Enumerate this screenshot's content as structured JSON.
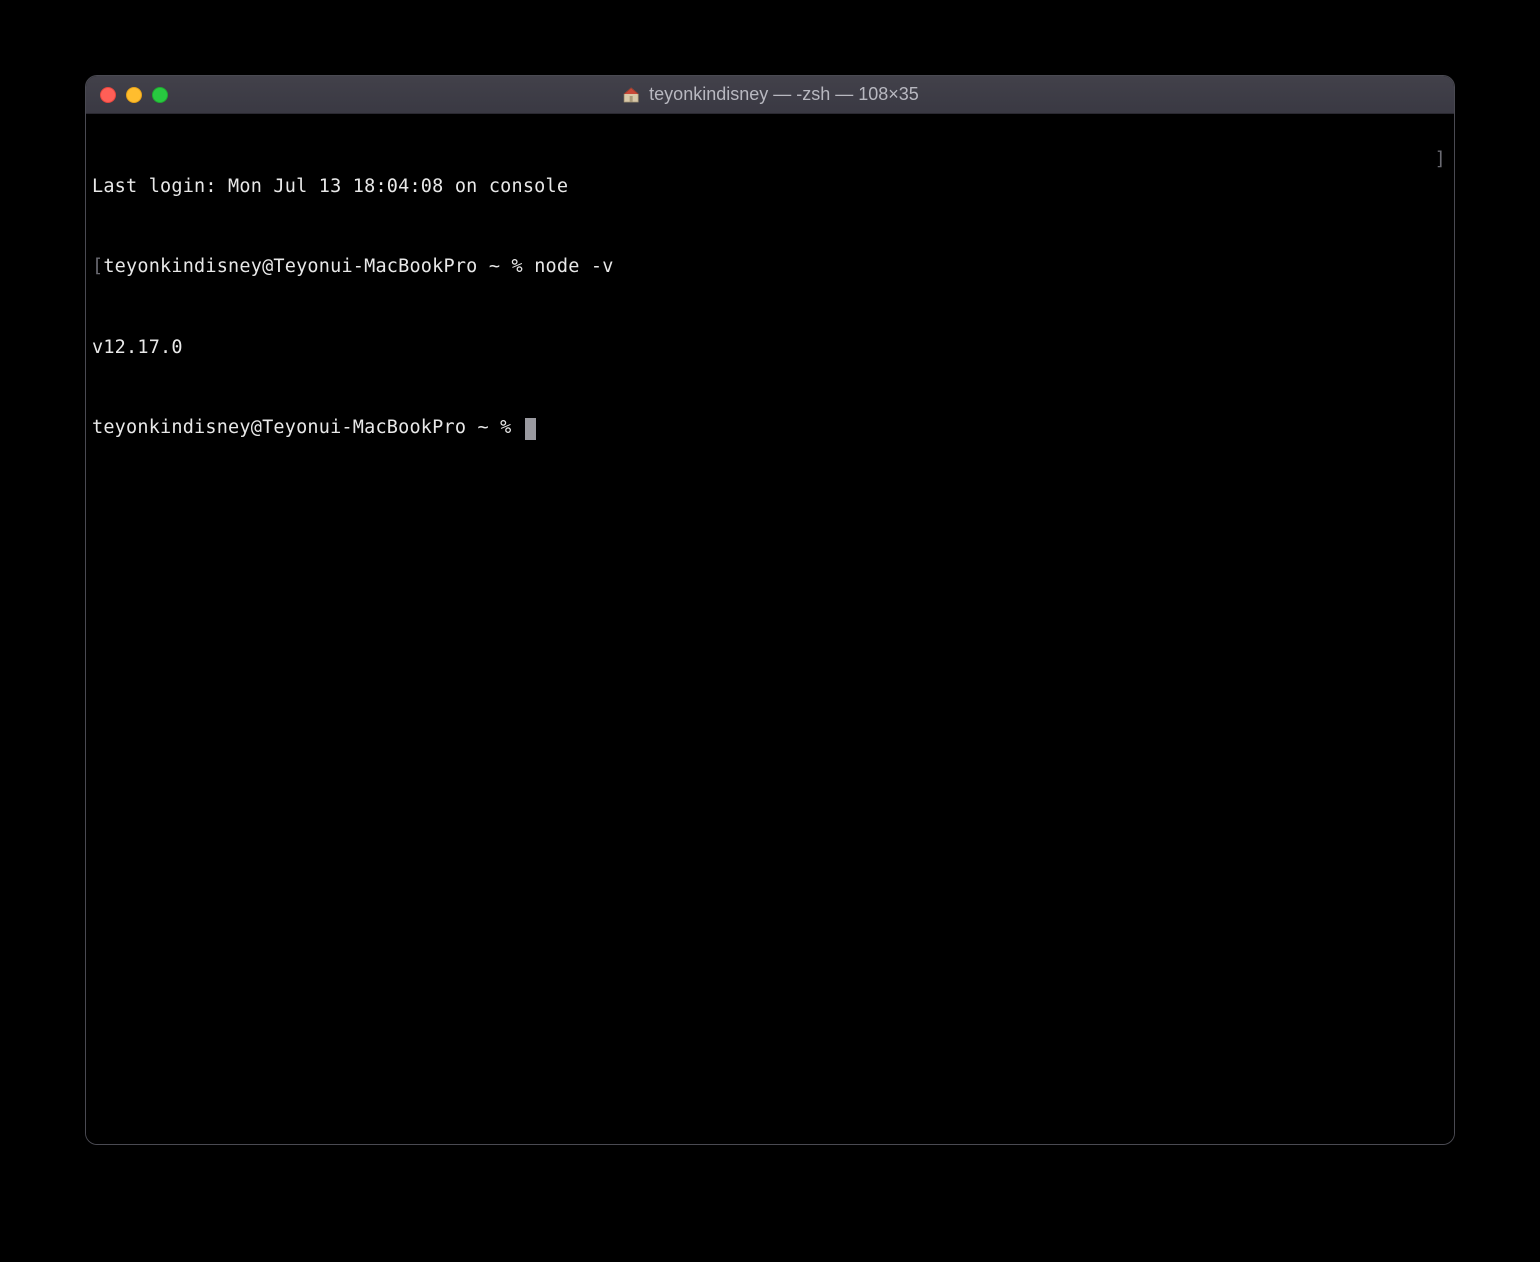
{
  "window": {
    "title": "teyonkindisney — -zsh — 108×35"
  },
  "terminal": {
    "last_login_line": "Last login: Mon Jul 13 18:04:08 on console",
    "prompt_open_bracket": "[",
    "prompt_close_bracket": "]",
    "prompt_user_host": "teyonkindisney@Teyonui-MacBookPro ~ % ",
    "command1": "node -v",
    "output1": "v12.17.0"
  }
}
